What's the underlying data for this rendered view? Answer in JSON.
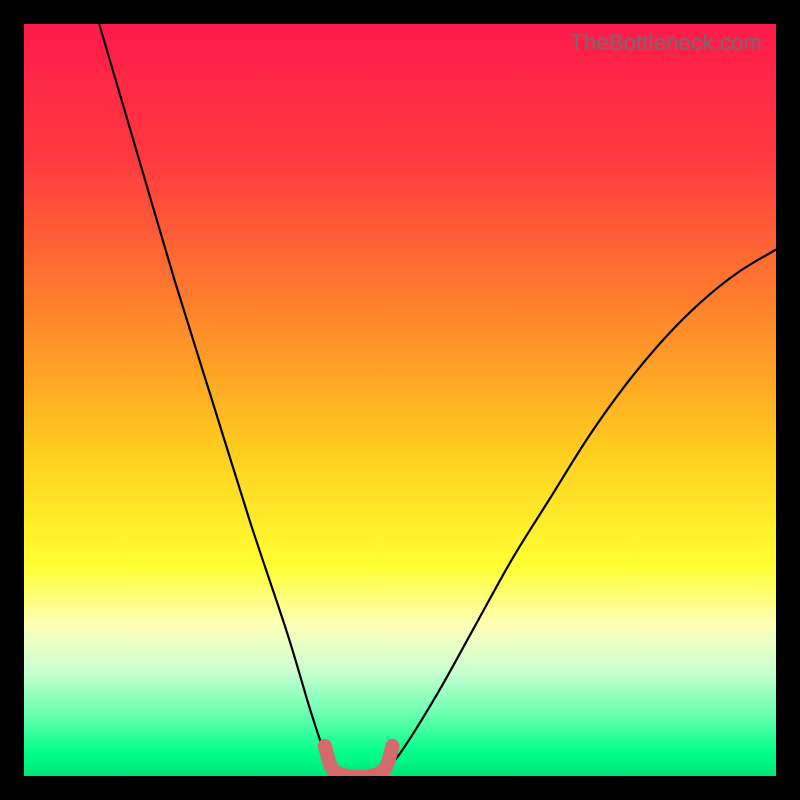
{
  "watermark": "TheBottleneck.com",
  "chart_data": {
    "type": "line",
    "title": "",
    "xlabel": "",
    "ylabel": "",
    "xlim": [
      0,
      100
    ],
    "ylim": [
      0,
      100
    ],
    "series": [
      {
        "name": "curve-left",
        "x": [
          10,
          15,
          20,
          25,
          30,
          35,
          38,
          40,
          41
        ],
        "y": [
          100,
          83,
          66,
          50,
          34,
          19,
          9,
          3,
          1
        ]
      },
      {
        "name": "curve-right",
        "x": [
          48,
          50,
          55,
          60,
          65,
          70,
          75,
          80,
          85,
          90,
          95,
          100
        ],
        "y": [
          1,
          3,
          11,
          20,
          29,
          37,
          45,
          52,
          58,
          63,
          67,
          70
        ]
      },
      {
        "name": "highlight-bottom",
        "x": [
          40,
          41,
          43,
          46,
          48,
          49
        ],
        "y": [
          4,
          1,
          0,
          0,
          1,
          4
        ]
      }
    ],
    "gradient_stops": [
      {
        "offset": 0,
        "color": "#ff1a4b"
      },
      {
        "offset": 18,
        "color": "#ff3a3f"
      },
      {
        "offset": 40,
        "color": "#ff8a2a"
      },
      {
        "offset": 58,
        "color": "#ffd21f"
      },
      {
        "offset": 72,
        "color": "#ffff33"
      },
      {
        "offset": 80,
        "color": "#fdffb8"
      },
      {
        "offset": 86,
        "color": "#ccffd2"
      },
      {
        "offset": 92,
        "color": "#66ffb0"
      },
      {
        "offset": 97,
        "color": "#00ff88"
      },
      {
        "offset": 100,
        "color": "#00e47a"
      }
    ],
    "highlight_color": "#d46a6a",
    "curve_color": "#000000"
  }
}
